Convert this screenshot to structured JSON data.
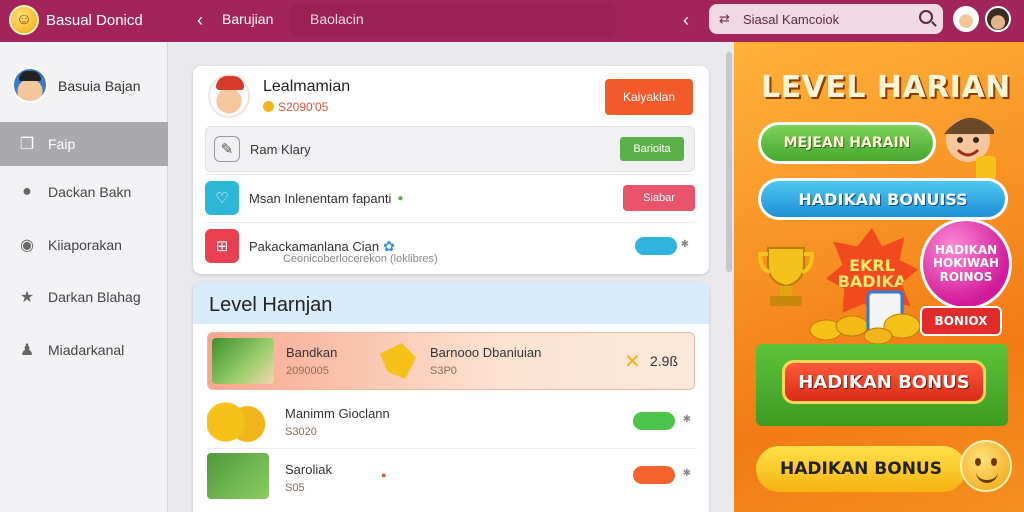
{
  "header": {
    "app_title": "Basual Donicd",
    "crumb_1": "Barujian",
    "crumb_2": "Baolacin",
    "search_placeholder": "Siasal Kamcoiok"
  },
  "sidebar": {
    "profile_name": "Basuia Bajan",
    "items": [
      {
        "label": "Faip",
        "icon": "book-icon"
      },
      {
        "label": "Dackan Bakn",
        "icon": "person-icon"
      },
      {
        "label": "Kiiaporakan",
        "icon": "chat-icon"
      },
      {
        "label": "Darkan Blahag",
        "icon": "star-icon"
      },
      {
        "label": "Miadarkanal",
        "icon": "user-icon"
      }
    ]
  },
  "card1": {
    "title": "Lealmamian",
    "subtitle": "S2090'05",
    "action_label": "Kaiyaklan",
    "rows": [
      {
        "text": "Ram Klary",
        "button": "Barioita"
      },
      {
        "text": "Msan Inlenentam fapanti",
        "button": "Siabar"
      },
      {
        "text": "Pakackamanlana Cian",
        "meta": "Ceonicoberlocerekon (loklibres)"
      }
    ]
  },
  "card2": {
    "title": "Level Harnjan",
    "featured": {
      "left_title": "Bandkan",
      "left_sub": "2090005",
      "mid_title": "Barnooo Dbaniuian",
      "mid_sub": "S3P0",
      "value": "2.9ß"
    },
    "items": [
      {
        "title": "Manimm Gioclann",
        "sub": "S3020"
      },
      {
        "title": "Saroliak",
        "sub": "S05"
      }
    ]
  },
  "promo": {
    "title": "LEVEL HARIAN",
    "pill_green": "MEJEAN HARAIN",
    "pill_blue": "HADIKAN BONUISS",
    "burst_1": "EKRL",
    "burst_2": "BADIKA",
    "ball_text": "HADIKAN HOKIWAH ROINOS",
    "tag": "BONIOX",
    "btn_red": "HADIKAN BONUS",
    "btn_yellow": "HADIKAN BONUS"
  },
  "colors": {
    "topbar": "#a3245a",
    "accent_orange": "#f25a2c",
    "accent_green": "#5bb04a",
    "accent_red": "#e9546a",
    "promo_bg": "#f5901f"
  }
}
